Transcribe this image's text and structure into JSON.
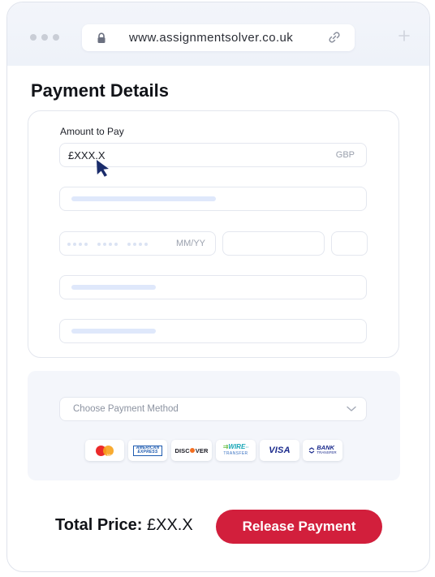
{
  "browser": {
    "url": "www.assignmentsolver.co.uk",
    "icons": [
      "lock-icon",
      "link-icon",
      "plus-icon"
    ]
  },
  "page": {
    "title": "Payment Details"
  },
  "form": {
    "amount_label": "Amount to Pay",
    "amount_value": "£XXX.X",
    "currency": "GBP",
    "card_expiry_placeholder": "MM/YY"
  },
  "payment_method": {
    "placeholder": "Choose Payment Method",
    "logos": [
      "Mastercard",
      "American Express",
      "Discover",
      "Wire Transfer",
      "Visa",
      "Bank Transfer"
    ],
    "logo_text": {
      "mastercard": "MasterCard",
      "amex_top": "AMERICAN",
      "amex_bottom": "EXPRESS",
      "discover_pre": "DISC",
      "discover_post": "VER",
      "wire_top": "WIRE",
      "wire_bottom": "TRANSFER",
      "visa": "VISA",
      "bank_top": "BANK",
      "bank_bottom": "TRANSFER"
    }
  },
  "footer": {
    "total_label": "Total Price:",
    "total_value": "£XX.X",
    "release_button": "Release Payment"
  },
  "colors": {
    "accent": "#d21f3c",
    "cursor": "#1a2c6b",
    "skeleton": "#dfe8fb"
  }
}
